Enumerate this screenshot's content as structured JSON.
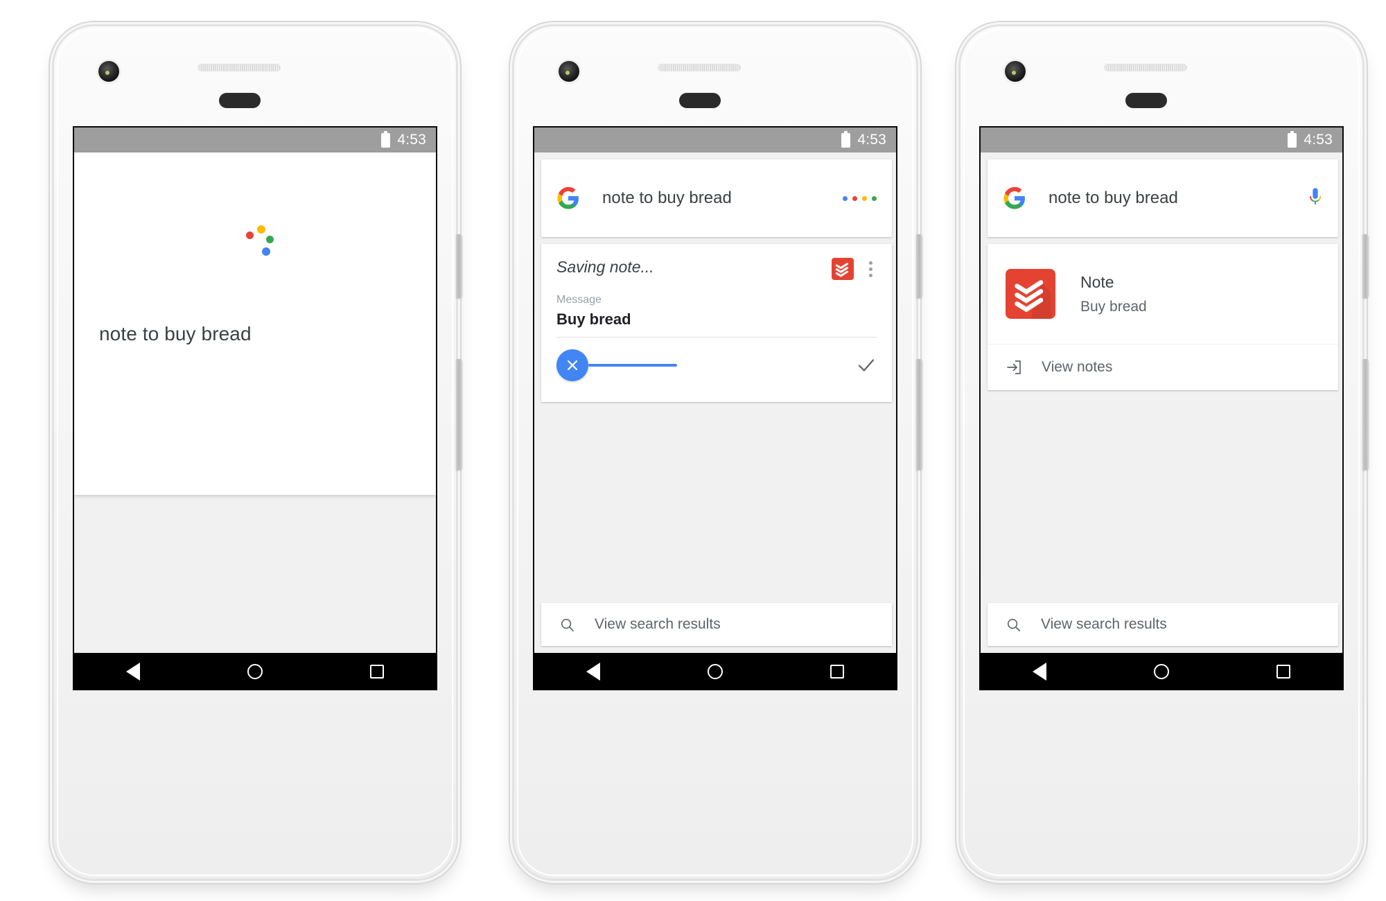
{
  "status_bar": {
    "time": "4:53",
    "battery_icon": "battery-icon"
  },
  "navigation_bar": {
    "back_label": "Back",
    "home_label": "Home",
    "recents_label": "Recents"
  },
  "phones": [
    {
      "id": "phone-listening",
      "assistant": {
        "listening_indicator": "google-assistant-dots",
        "transcript": "note to buy bread"
      }
    },
    {
      "id": "phone-saving",
      "query_card": {
        "logo": "google-g-logo",
        "query": "note to buy bread",
        "trailing_icon": "loading-dots-icon"
      },
      "note_card": {
        "status": "Saving note...",
        "app_icon": "todoist-icon",
        "overflow_icon": "kebab-menu-icon",
        "field_label": "Message",
        "field_value": "Buy bread",
        "cancel_icon": "close-icon",
        "confirm_icon": "check-icon",
        "progress_percent": 45
      },
      "footer": {
        "icon": "search-icon",
        "label": "View search results"
      }
    },
    {
      "id": "phone-result",
      "query_card": {
        "logo": "google-g-logo",
        "query": "note to buy bread",
        "trailing_icon": "microphone-icon"
      },
      "result_card": {
        "app_icon": "todoist-icon",
        "title": "Note",
        "subtitle": "Buy bread",
        "action_icon": "open-in-app-icon",
        "action_label": "View notes"
      },
      "footer": {
        "icon": "search-icon",
        "label": "View search results"
      }
    }
  ],
  "colors": {
    "google_blue": "#4285F4",
    "google_red": "#EA4335",
    "google_yellow": "#FBBC05",
    "google_green": "#34A853",
    "todoist_red": "#E44332",
    "status_bar_gray": "#9E9E9E",
    "screen_background": "#F1F1F1"
  }
}
